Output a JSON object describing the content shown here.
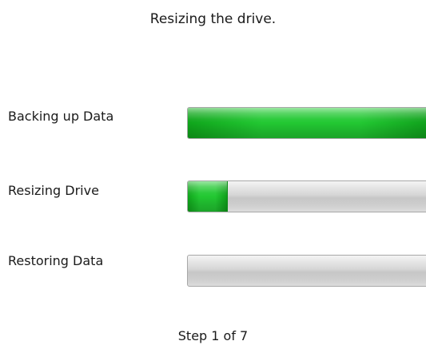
{
  "title": "Resizing the drive.",
  "stages": [
    {
      "label": "Backing up Data",
      "progress": 1.0
    },
    {
      "label": "Resizing Drive",
      "progress": 0.16
    },
    {
      "label": "Restoring Data",
      "progress": 0.0
    }
  ],
  "step_text": "Step 1 of 7",
  "colors": {
    "progress_fill": "#22c832",
    "track": "#d6d6d6"
  }
}
